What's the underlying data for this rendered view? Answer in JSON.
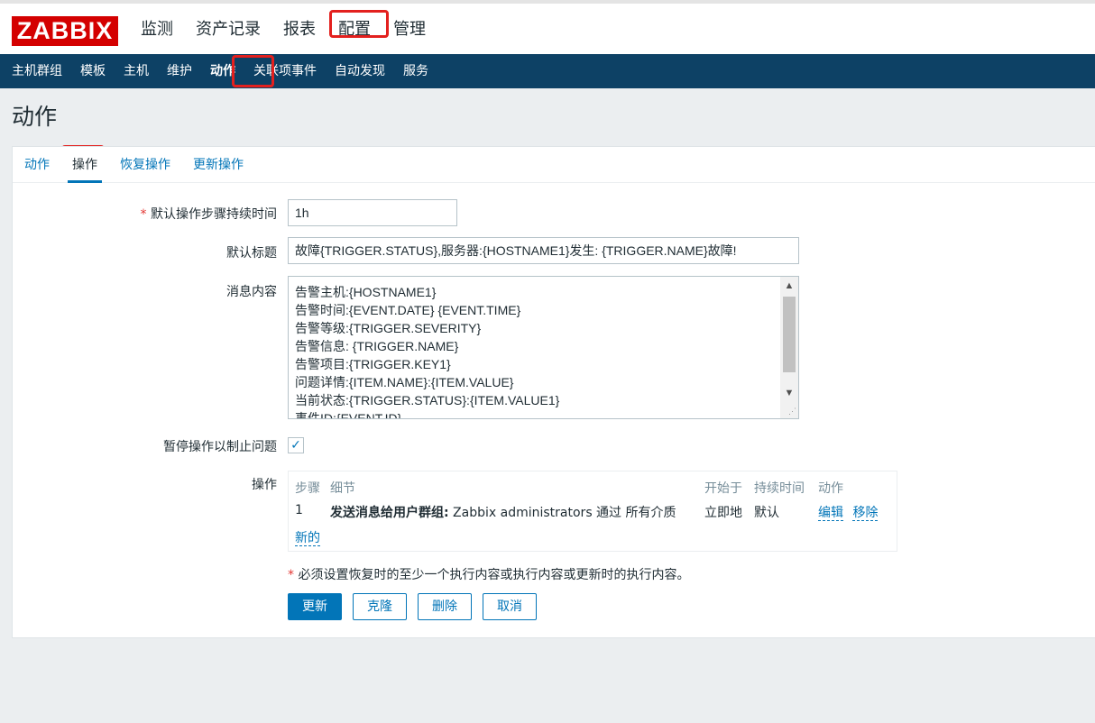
{
  "logo": "ZABBIX",
  "main_nav": [
    "监测",
    "资产记录",
    "报表",
    "配置",
    "管理"
  ],
  "sub_nav": [
    "主机群组",
    "模板",
    "主机",
    "维护",
    "动作",
    "关联项事件",
    "自动发现",
    "服务"
  ],
  "page_title": "动作",
  "tabs": [
    "动作",
    "操作",
    "恢复操作",
    "更新操作"
  ],
  "form": {
    "step_duration": {
      "label": "默认操作步骤持续时间",
      "required_mark": "*",
      "value": "1h"
    },
    "subject": {
      "label": "默认标题",
      "value": "故障{TRIGGER.STATUS},服务器:{HOSTNAME1}发生: {TRIGGER.NAME}故障!"
    },
    "message": {
      "label": "消息内容",
      "lines": [
        "告警主机:{HOSTNAME1}",
        "告警时间:{EVENT.DATE} {EVENT.TIME}",
        "告警等级:{TRIGGER.SEVERITY}",
        "告警信息: {TRIGGER.NAME}",
        "告警项目:{TRIGGER.KEY1}",
        "问题详情:{ITEM.NAME}:{ITEM.VALUE}",
        "当前状态:{TRIGGER.STATUS}:{ITEM.VALUE1}",
        "事件ID:{EVENT.ID}"
      ]
    },
    "pause": {
      "label": "暂停操作以制止问题",
      "checked": true
    },
    "operations": {
      "label": "操作",
      "headers": {
        "step": "步骤",
        "details": "细节",
        "start_in": "开始于",
        "duration": "持续时间",
        "action": "动作"
      },
      "rows": [
        {
          "step": "1",
          "details_bold": "发送消息给用户群组:",
          "details_rest": " Zabbix administrators 通过 所有介质",
          "start_in": "立即地",
          "duration": "默认",
          "edit": "编辑",
          "remove": "移除"
        }
      ],
      "new_link": "新的"
    },
    "note": {
      "mark": "*",
      "text": " 必须设置恢复时的至少一个执行内容或执行内容或更新时的执行内容。"
    }
  },
  "buttons": {
    "update": "更新",
    "clone": "克隆",
    "delete": "删除",
    "cancel": "取消"
  }
}
